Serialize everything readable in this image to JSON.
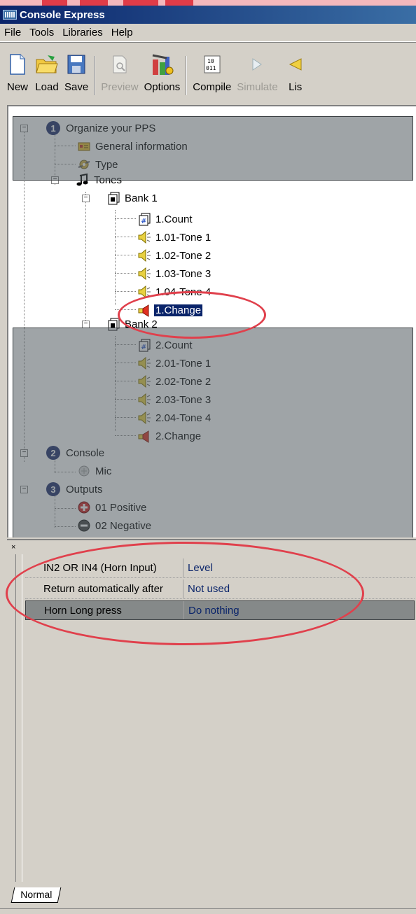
{
  "window": {
    "title": "Console Express"
  },
  "menu": [
    "File",
    "Tools",
    "Libraries",
    "Help"
  ],
  "toolbar": {
    "new": "New",
    "load": "Load",
    "save": "Save",
    "preview": "Preview",
    "options": "Options",
    "compile": "Compile",
    "simulate": "Simulate",
    "list": "Lis"
  },
  "tree": {
    "organize": {
      "badge": "1",
      "label": "Organize your PPS"
    },
    "general": "General information",
    "type": "Type",
    "tones": "Tones",
    "bank1": {
      "label": "Bank 1",
      "count": "1.Count",
      "tones": [
        "1.01-Tone 1",
        "1.02-Tone 2",
        "1.03-Tone 3",
        "1.04-Tone 4"
      ],
      "change": "1.Change"
    },
    "bank2": {
      "label": "Bank 2",
      "count": "2.Count",
      "tones": [
        "2.01-Tone 1",
        "2.02-Tone 2",
        "2.03-Tone 3",
        "2.04-Tone 4"
      ],
      "change": "2.Change"
    },
    "console": {
      "badge": "2",
      "label": "Console",
      "mic": "Mic"
    },
    "outputs": {
      "badge": "3",
      "label": "Outputs",
      "positive": "01 Positive",
      "negative": "02 Negative"
    }
  },
  "properties": [
    {
      "name": "IN2 OR IN4 (Horn Input)",
      "value": "Level"
    },
    {
      "name": "Return automatically after",
      "value": "Not used"
    },
    {
      "name": "Horn Long press",
      "value": "Do nothing"
    }
  ],
  "tabs": {
    "normal": "Normal"
  },
  "colors": {
    "annotation": "#e0404c",
    "selection": "#0a246a",
    "titlebar": "#0a246a"
  }
}
